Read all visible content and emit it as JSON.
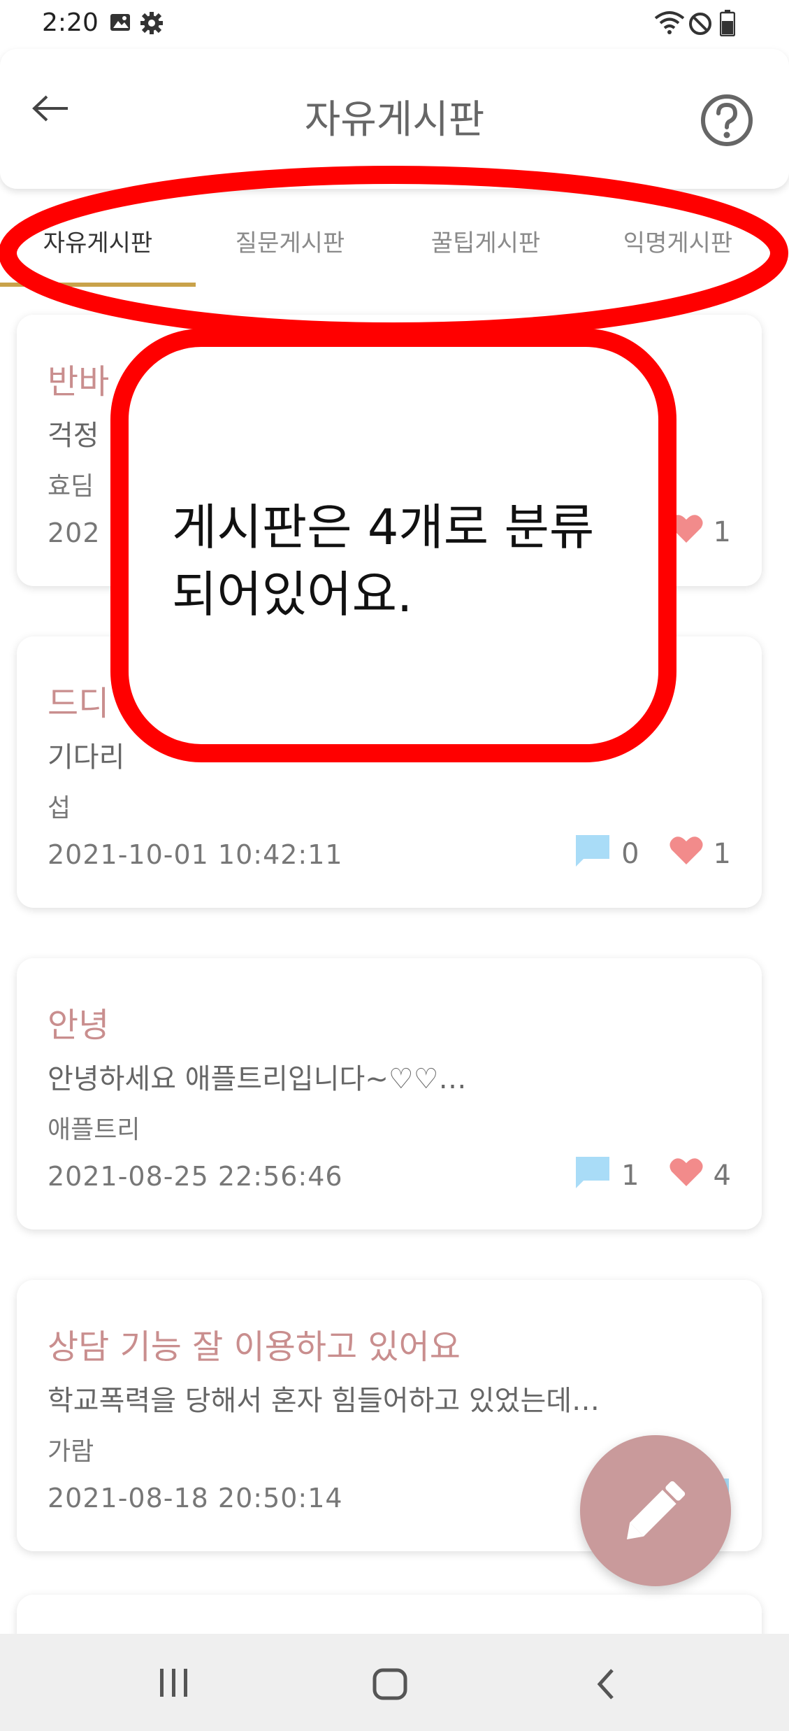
{
  "status_bar": {
    "time": "2:20",
    "icons": [
      "image-icon",
      "gear-icon",
      "wifi-icon",
      "dnd-icon",
      "battery-icon"
    ]
  },
  "header": {
    "title": "자유게시판",
    "back_icon": "arrow-left-icon",
    "help_icon": "help-circle-icon"
  },
  "tabs": [
    {
      "label": "자유게시판",
      "active": true
    },
    {
      "label": "질문게시판",
      "active": false
    },
    {
      "label": "꿀팁게시판",
      "active": false
    },
    {
      "label": "익명게시판",
      "active": false
    }
  ],
  "posts": [
    {
      "title": "반바",
      "preview": "걱정",
      "author": "효딤",
      "date": "202",
      "comments": "",
      "likes": "1"
    },
    {
      "title": "드디",
      "preview": "기다리",
      "author": "섭",
      "date": "2021-10-01 10:42:11",
      "comments": "0",
      "likes": "1"
    },
    {
      "title": "안녕",
      "preview": "안녕하세요 애플트리입니다~♡♡…",
      "author": "애플트리",
      "date": "2021-08-25 22:56:46",
      "comments": "1",
      "likes": "4"
    },
    {
      "title": "상담 기능 잘 이용하고 있어요",
      "preview": "학교폭력을 당해서 혼자 힘들어하고 있었는데…",
      "author": "가람",
      "date": "2021-08-18 20:50:14",
      "comments": "",
      "likes": ""
    }
  ],
  "fab": {
    "icon": "pencil-icon"
  },
  "annotation": {
    "callout_text": "게시판은 4개로 분류\n되어있어요.",
    "highlight_color": "#ff0000"
  },
  "colors": {
    "accent": "#c9a24a",
    "post_title": "#c98e8e",
    "fab": "#c99a9b",
    "comment_icon": "#a9dcf7",
    "heart_icon": "#f28b8b"
  }
}
